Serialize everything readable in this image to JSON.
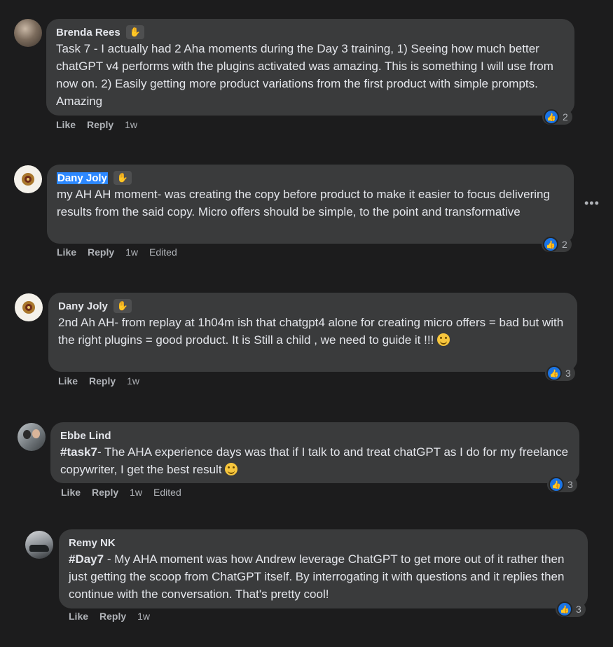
{
  "comments": [
    {
      "author": "Brenda Rees",
      "text": "Task 7 - I actually had 2 Aha moments during the Day 3 training, 1) Seeing how much better chatGPT v4 performs with the plugins activated was amazing. This is something I will use from now on. 2) Easily getting more product variations from the first product with simple prompts. Amazing",
      "reactions": "2",
      "like_label": "Like",
      "reply_label": "Reply",
      "time": "1w"
    },
    {
      "author": "Dany Joly",
      "text": "my AH AH moment- was creating the copy before product to make it easier to focus delivering results from the said copy. Micro offers should be simple, to the point and transformative",
      "reactions": "2",
      "like_label": "Like",
      "reply_label": "Reply",
      "time": "1w",
      "edited": "Edited"
    },
    {
      "author": "Dany Joly",
      "text": "2nd Ah AH- from replay at 1h04m ish that chatgpt4 alone for creating micro offers = bad but with the right plugins = good product. It is Still a child , we need to guide it !!!",
      "reactions": "3",
      "like_label": "Like",
      "reply_label": "Reply",
      "time": "1w"
    },
    {
      "author": "Ebbe Lind",
      "tag": "#task7",
      "text": "- The AHA experience days was that if I talk to and treat chatGPT as I do for my freelance copywriter, I get the best result",
      "reactions": "3",
      "like_label": "Like",
      "reply_label": "Reply",
      "time": "1w",
      "edited": "Edited"
    },
    {
      "author": "Remy NK",
      "tag": "#Day7",
      "text": " - My AHA moment was how Andrew leverage ChatGPT to get more out of it rather then just getting the scoop from ChatGPT itself. By interrogating it with questions and it replies then continue with the conversation. That's pretty cool!",
      "reactions": "3",
      "like_label": "Like",
      "reply_label": "Reply",
      "time": "1w"
    }
  ],
  "icons": {
    "wave": "waving-hand-icon",
    "like": "thumbs-up-icon",
    "more": "more-options-icon",
    "emoji_grin": "grinning-face-emoji",
    "emoji_smile": "smiling-face-emoji"
  },
  "colors": {
    "background": "#1c1c1d",
    "bubble": "#3a3b3c",
    "like_blue": "#1b74e4",
    "highlight": "#2d88ff"
  }
}
